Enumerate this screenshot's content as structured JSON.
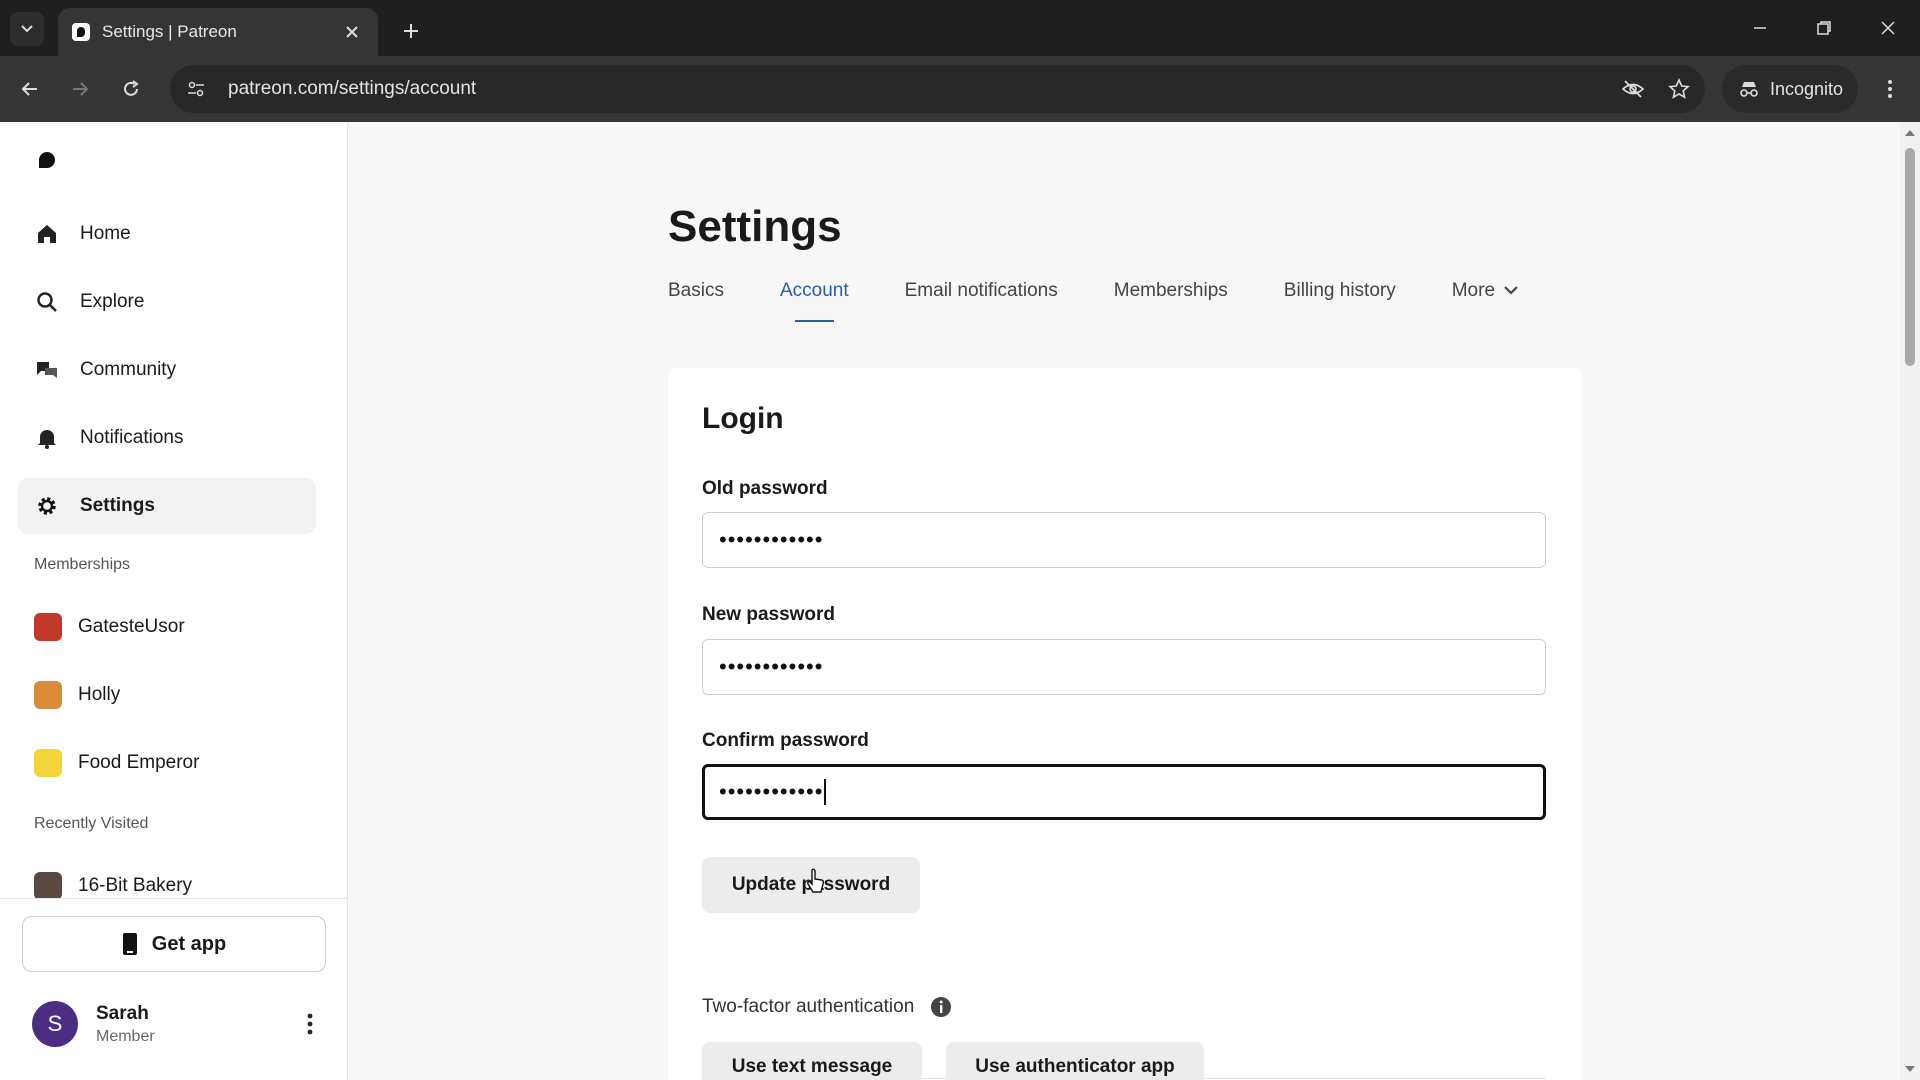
{
  "browser": {
    "tab_title": "Settings | Patreon",
    "url": "patreon.com/settings/account",
    "incognito_label": "Incognito"
  },
  "sidebar": {
    "nav": [
      {
        "label": "Home",
        "icon": "home-icon"
      },
      {
        "label": "Explore",
        "icon": "search-icon"
      },
      {
        "label": "Community",
        "icon": "chat-icon"
      },
      {
        "label": "Notifications",
        "icon": "bell-icon"
      },
      {
        "label": "Settings",
        "icon": "gear-icon",
        "active": true
      }
    ],
    "memberships_heading": "Memberships",
    "memberships": [
      {
        "label": "GatesteUsor",
        "color": "#c0392b"
      },
      {
        "label": "Holly",
        "color": "#d98c3a"
      },
      {
        "label": "Food Emperor",
        "color": "#f2d43b"
      }
    ],
    "recent_heading": "Recently Visited",
    "recent": [
      {
        "label": "16-Bit Bakery",
        "color": "#5a4a42"
      }
    ],
    "get_app_label": "Get app",
    "user": {
      "initial": "S",
      "name": "Sarah",
      "role": "Member",
      "avatar_color": "#4b2e83"
    }
  },
  "main": {
    "title": "Settings",
    "tabs": [
      "Basics",
      "Account",
      "Email notifications",
      "Memberships",
      "Billing history",
      "More"
    ],
    "active_tab": "Account",
    "login": {
      "heading": "Login",
      "old_password_label": "Old password",
      "old_password_value": "••••••••••••",
      "new_password_label": "New password",
      "new_password_value": "••••••••••••",
      "confirm_password_label": "Confirm password",
      "confirm_password_value": "••••••••••••",
      "update_button": "Update password"
    },
    "two_factor": {
      "label": "Two-factor authentication",
      "text_message_button": "Use text message",
      "authenticator_button": "Use authenticator app"
    }
  },
  "colors": {
    "accent": "#2b5ca6",
    "chrome_dark": "#1f1f1f",
    "chrome_toolbar": "#353535"
  }
}
